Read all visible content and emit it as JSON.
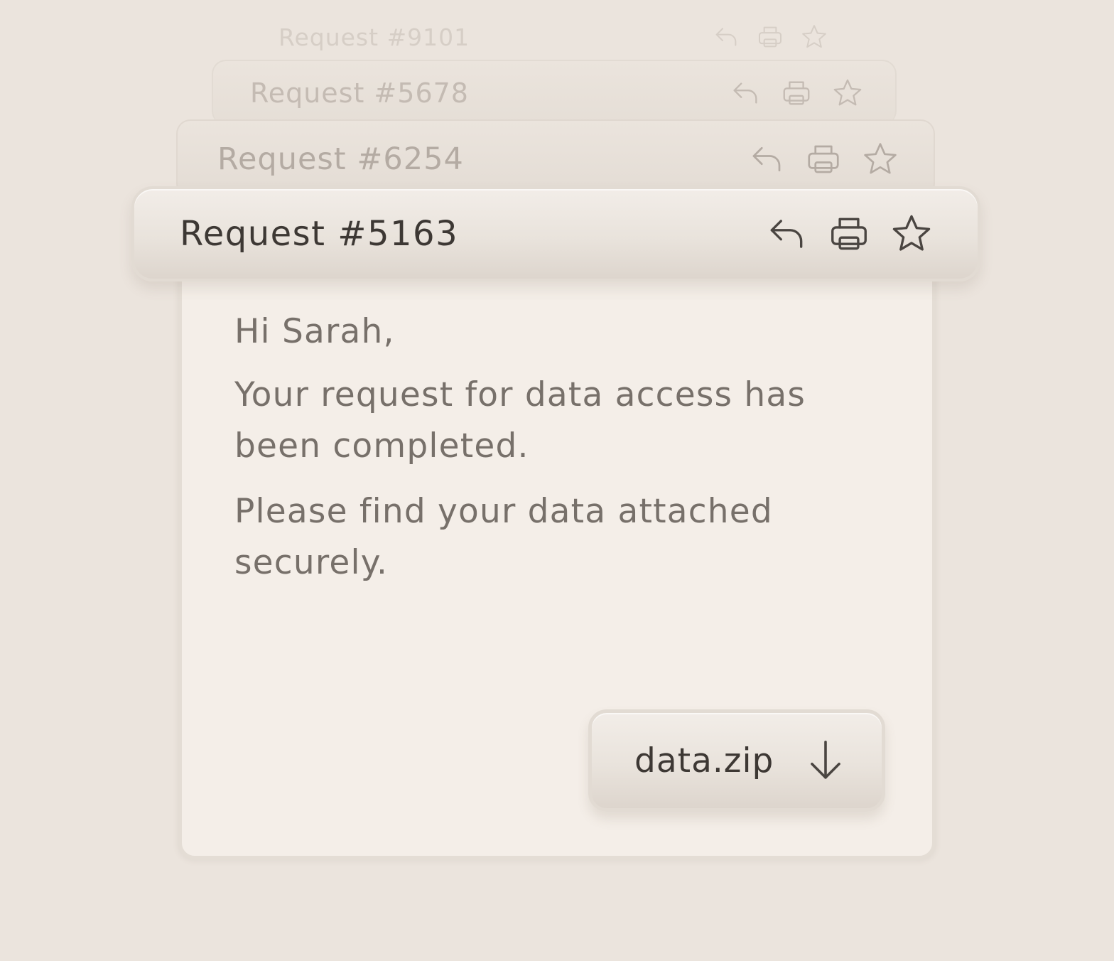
{
  "stack": [
    {
      "title": "Request #9101",
      "icons": [
        "reply-icon",
        "print-icon",
        "star-icon"
      ]
    },
    {
      "title": "Request #5678",
      "icons": [
        "reply-icon",
        "print-icon",
        "star-icon"
      ]
    },
    {
      "title": "Request #6254",
      "icons": [
        "reply-icon",
        "print-icon",
        "star-icon"
      ]
    }
  ],
  "email": {
    "title": "Request #5163",
    "icons": [
      "reply-icon",
      "print-icon",
      "star-icon"
    ],
    "greeting": "Hi Sarah,",
    "body": [
      "Your request for data access has been completed.",
      "Please find your data attached securely."
    ],
    "attachment": {
      "filename": "data.zip",
      "icon": "download-arrow-icon"
    }
  },
  "colors": {
    "background": "#ebe4dd",
    "card": "#f4eee8",
    "text_dark": "#3d3834",
    "text_body": "#77706a"
  }
}
